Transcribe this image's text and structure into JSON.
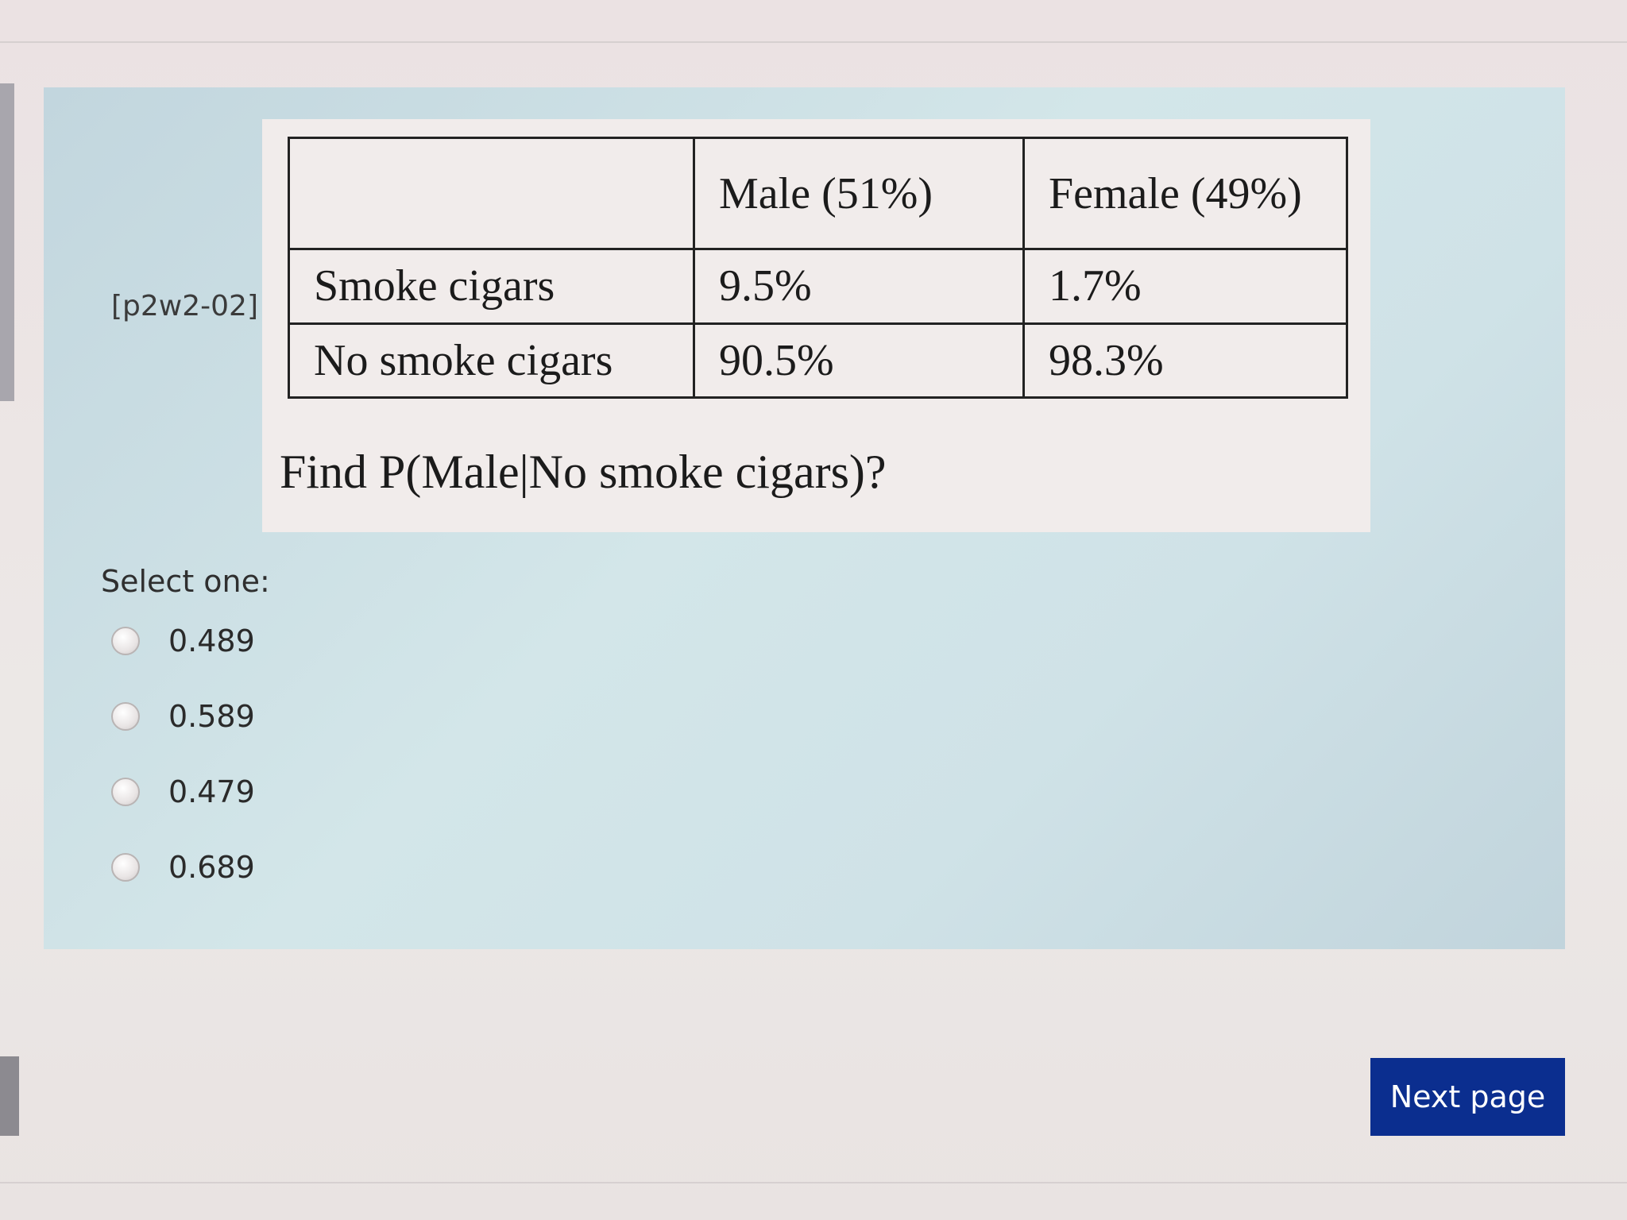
{
  "question": {
    "id": "[p2w2-02]",
    "table": {
      "header": [
        "",
        "Male (51%)",
        "Female (49%)"
      ],
      "rows": [
        [
          "Smoke cigars",
          "9.5%",
          "1.7%"
        ],
        [
          "No smoke cigars",
          "90.5%",
          "98.3%"
        ]
      ]
    },
    "prompt": "Find P(Male|No smoke cigars)?",
    "select_label": "Select one:",
    "options": [
      "0.489",
      "0.589",
      "0.479",
      "0.689"
    ]
  },
  "navigation": {
    "next_label": "Next page"
  },
  "colors": {
    "panel": "#cfe2e7",
    "button": "#0b2e8f"
  }
}
